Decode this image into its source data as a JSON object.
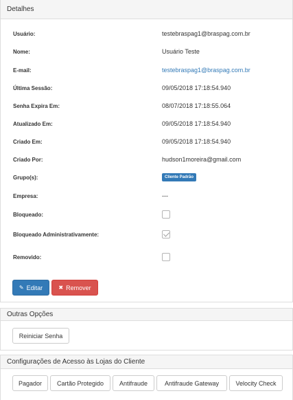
{
  "details": {
    "heading": "Detalhes",
    "rows": [
      {
        "label": "Usuário:",
        "value": "testebraspag1@braspag.com.br"
      },
      {
        "label": "Nome:",
        "value": "Usuário Teste"
      },
      {
        "label": "E-mail:",
        "value": "testebraspag1@braspag.com.br"
      },
      {
        "label": "Última Sessão:",
        "value": "09/05/2018 17:18:54.940"
      },
      {
        "label": "Senha Expira Em:",
        "value": "08/07/2018 17:18:55.064"
      },
      {
        "label": "Atualizado Em:",
        "value": "09/05/2018 17:18:54.940"
      },
      {
        "label": "Criado Em:",
        "value": "09/05/2018 17:18:54.940"
      },
      {
        "label": "Criado Por:",
        "value": "hudson1moreira@gmail.com"
      },
      {
        "label": "Grupo(s):",
        "value": "Cliente Padrão"
      },
      {
        "label": "Empresa:",
        "value": "---"
      },
      {
        "label": "Bloqueado:",
        "checked": false
      },
      {
        "label": "Bloqueado Administrativamente:",
        "checked": true
      },
      {
        "label": "Removido:",
        "checked": false
      }
    ],
    "edit_label": "Editar",
    "remove_label": "Remover",
    "edit_icon": "edit-icon",
    "remove_icon": "close-icon"
  },
  "other_options": {
    "heading": "Outras Opções",
    "reset_password_label": "Reiniciar Senha"
  },
  "store_access": {
    "heading": "Configurações de Acesso às Lojas do Cliente",
    "buttons": [
      "Pagador",
      "Cartão Protegido",
      "Antifraude",
      "Antifraude Gateway",
      "Velocity Check"
    ]
  },
  "colors": {
    "primary": "#337ab7",
    "danger": "#d9534f",
    "link": "#337ab7"
  }
}
